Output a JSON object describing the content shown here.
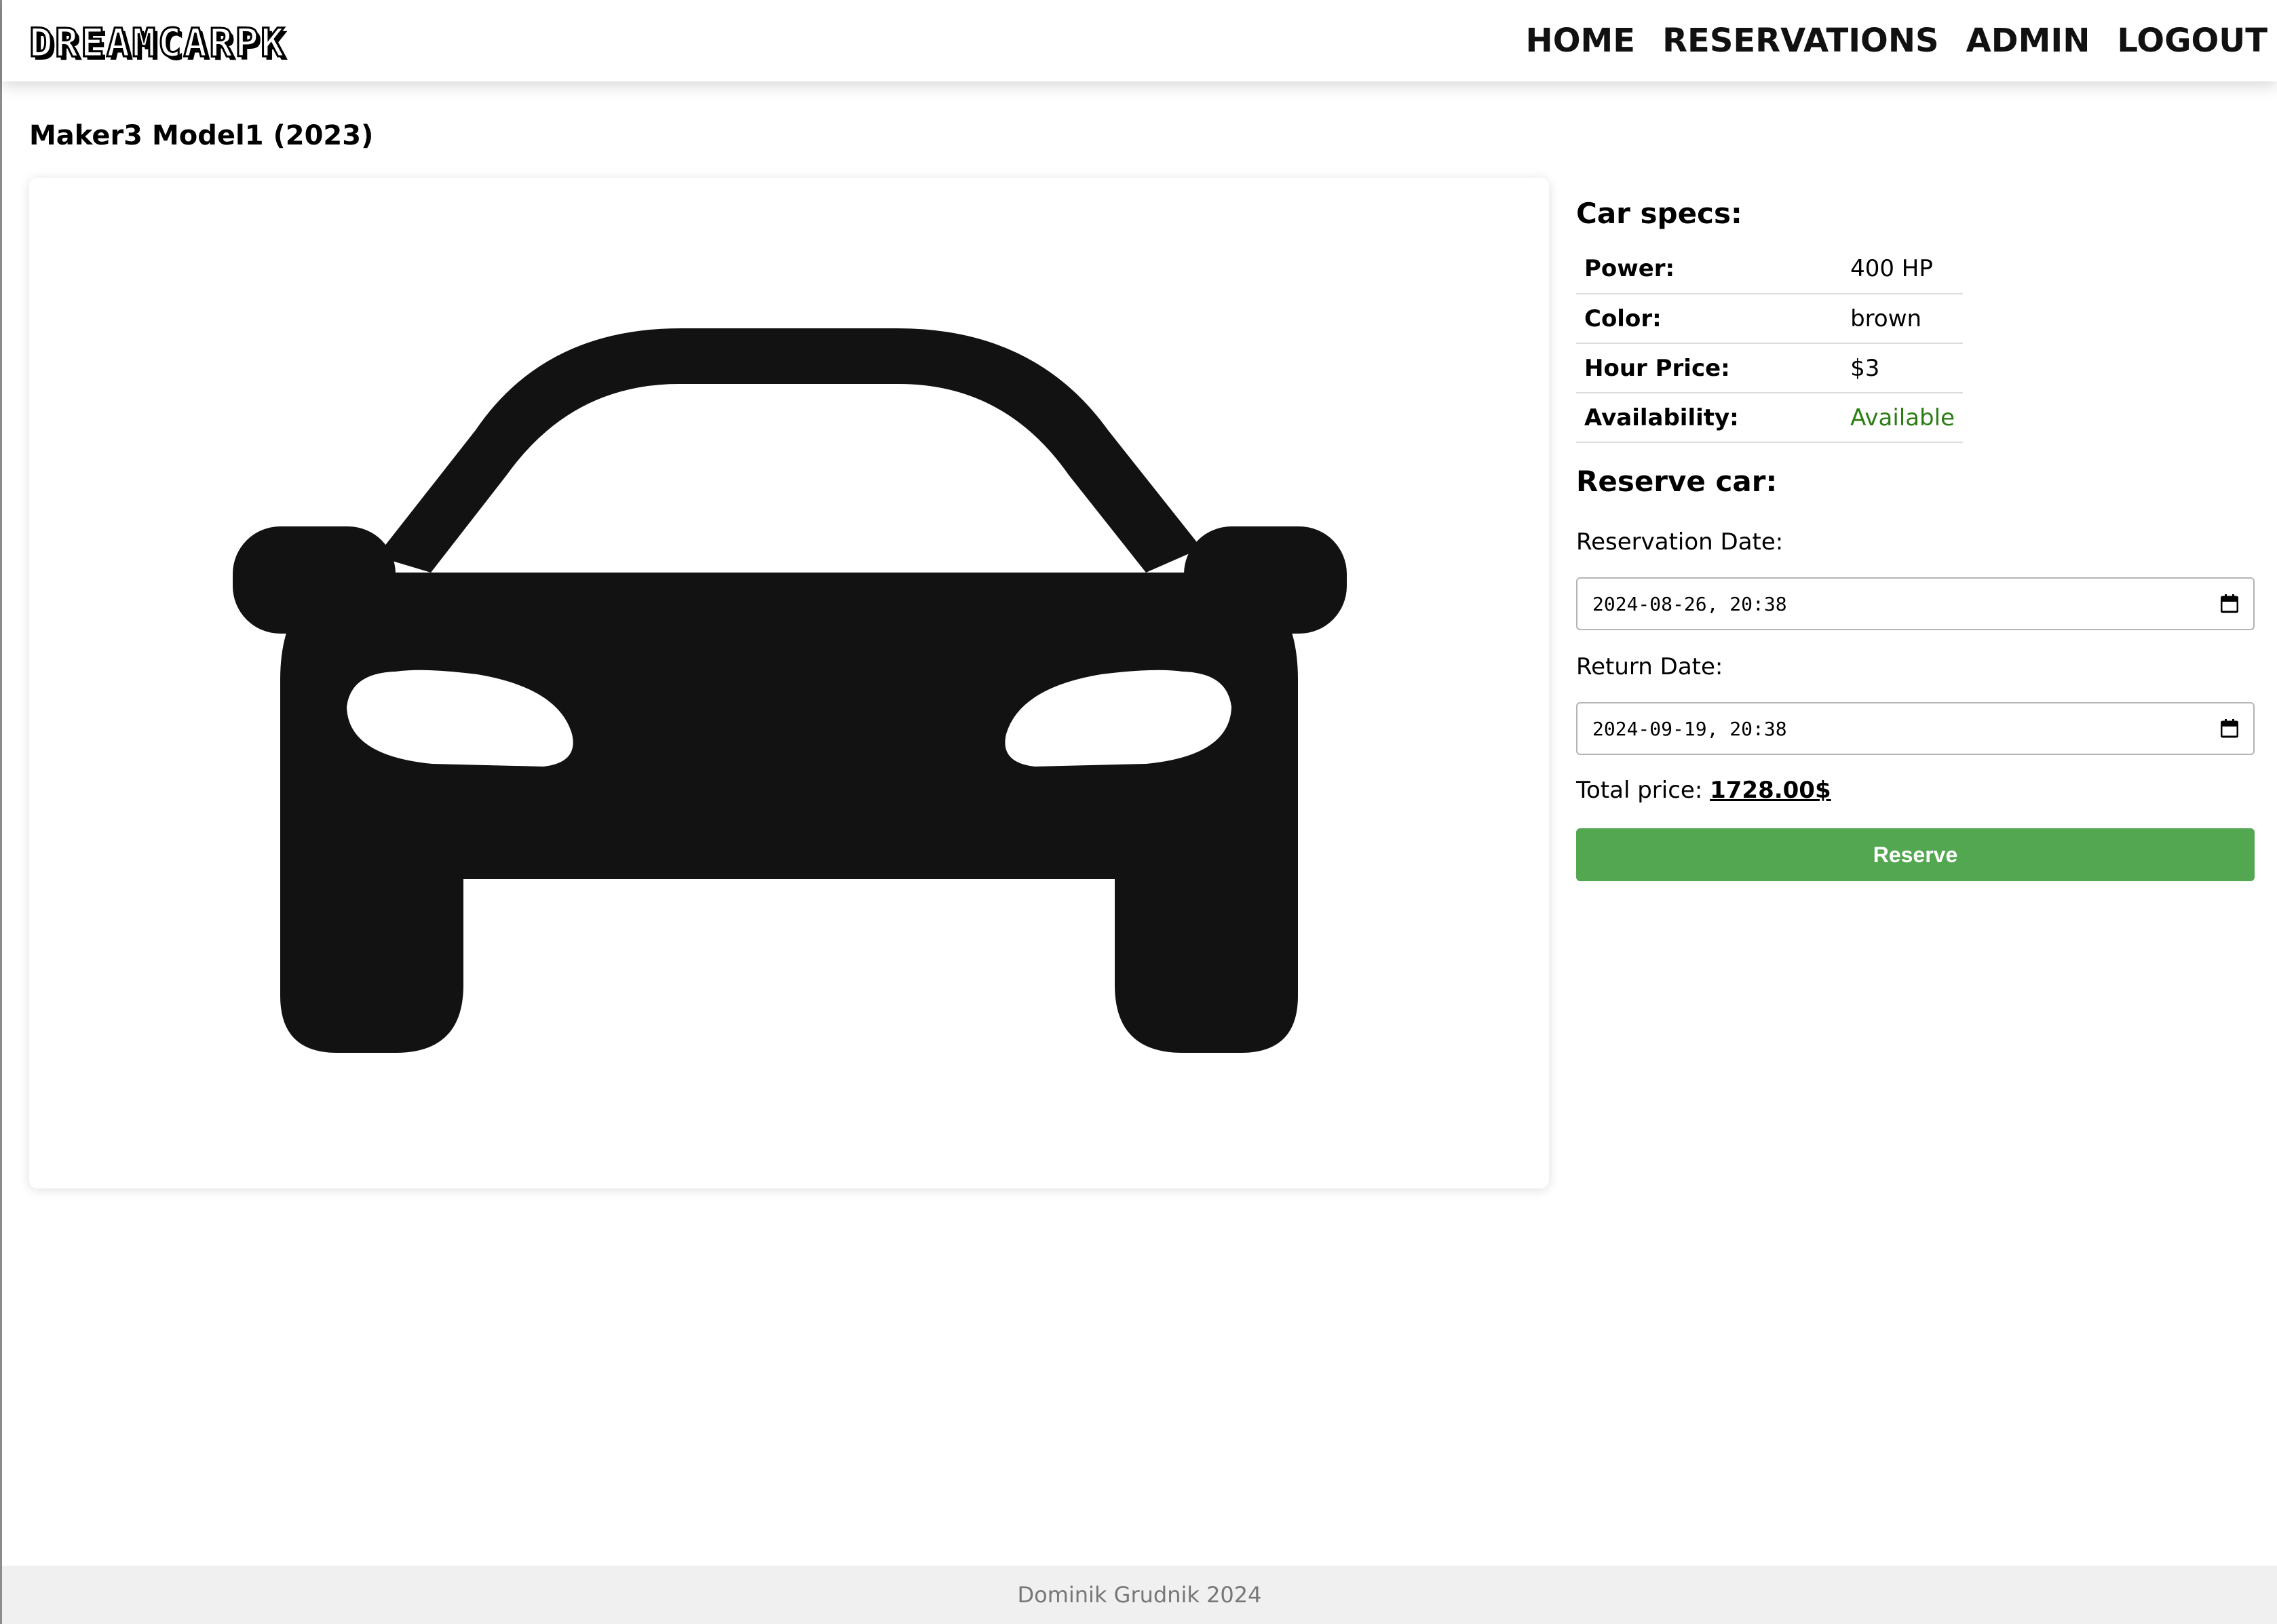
{
  "header": {
    "logo": "DREAMCARPK",
    "nav": [
      "HOME",
      "RESERVATIONS",
      "ADMIN",
      "LOGOUT"
    ]
  },
  "car": {
    "title": "Maker3 Model1 (2023)",
    "image_icon": "car-front-icon"
  },
  "specs": {
    "heading": "Car specs:",
    "rows": [
      {
        "label": "Power:",
        "value": "400 HP"
      },
      {
        "label": "Color:",
        "value": "brown"
      },
      {
        "label": "Hour Price:",
        "value": "$3"
      },
      {
        "label": "Availability:",
        "value": "Available"
      }
    ]
  },
  "reserve": {
    "heading": "Reserve car:",
    "reservation_label": "Reservation Date:",
    "reservation_value": "2024-08-26, 20:38",
    "return_label": "Return Date:",
    "return_value": "2024-09-19, 20:38",
    "total_label": "Total price:",
    "total_value": "1728.00$",
    "button_label": "Reserve"
  },
  "footer": {
    "text": "Dominik Grudnik 2024"
  },
  "colors": {
    "accent_green": "#53a751",
    "available_green": "#2c7d14",
    "icon_black": "#121212",
    "footer_bg": "#f0f0f0"
  }
}
